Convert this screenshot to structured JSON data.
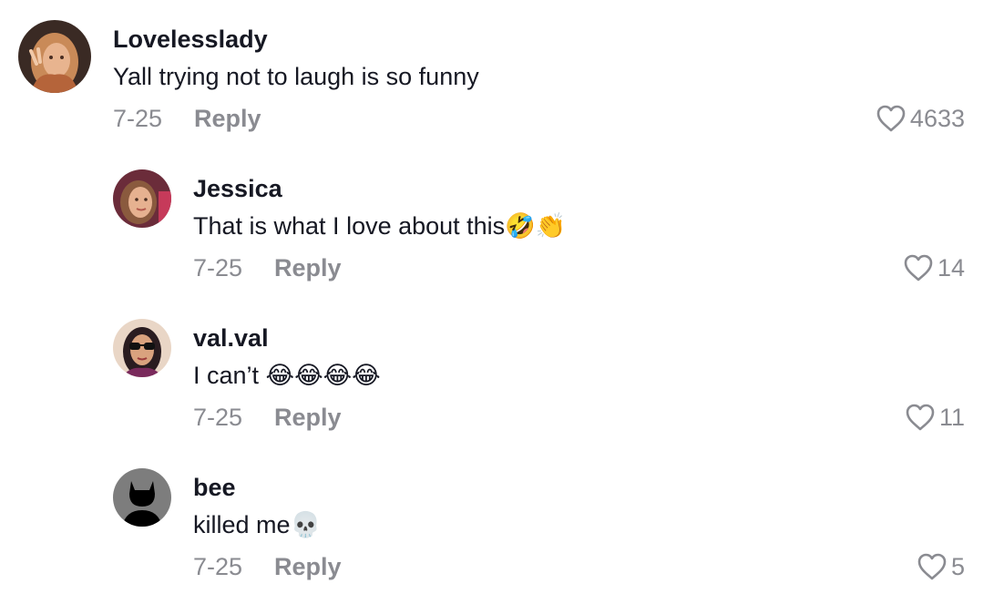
{
  "comments": [
    {
      "username": "Lovelesslady",
      "text": "Yall trying not to laugh is so funny",
      "date": "7-25",
      "reply_label": "Reply",
      "likes": "4633",
      "avatar": "user-avatar-photo"
    },
    {
      "username": "Jessica",
      "text": "That is what I love about this🤣👏",
      "date": "7-25",
      "reply_label": "Reply",
      "likes": "14",
      "avatar": "user-avatar-photo"
    },
    {
      "username": "val.val",
      "text": "I can’t 😂😂😂😂",
      "date": "7-25",
      "reply_label": "Reply",
      "likes": "11",
      "avatar": "user-avatar-photo"
    },
    {
      "username": "bee",
      "text": "killed me💀",
      "date": "7-25",
      "reply_label": "Reply",
      "likes": "5",
      "avatar": "default-devil-avatar"
    }
  ],
  "colors": {
    "text_primary": "#161823",
    "text_secondary": "#8a8b91",
    "background": "#ffffff"
  },
  "icons": {
    "like": "heart-outline-icon"
  }
}
